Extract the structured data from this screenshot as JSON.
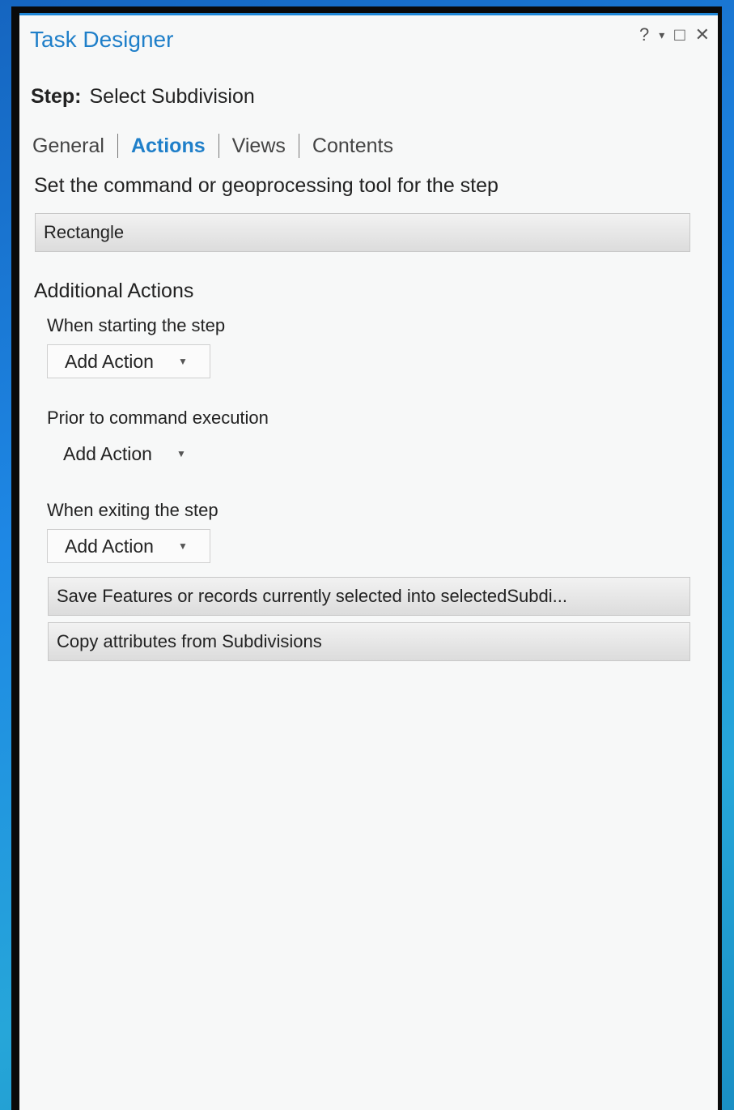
{
  "window": {
    "title": "Task Designer",
    "help": "?",
    "pin": "▾",
    "maximize": "□",
    "close": "✕"
  },
  "step": {
    "label": "Step:",
    "value": "Select Subdivision"
  },
  "tabs": [
    {
      "label": "General",
      "active": false
    },
    {
      "label": "Actions",
      "active": true
    },
    {
      "label": "Views",
      "active": false
    },
    {
      "label": "Contents",
      "active": false
    }
  ],
  "command": {
    "heading": "Set the command or geoprocessing tool for the step",
    "value": "Rectangle"
  },
  "additional": {
    "title": "Additional Actions",
    "starting_label": "When starting the step",
    "prior_label": "Prior to command execution",
    "exiting_label": "When exiting the step",
    "add_action_label": "Add Action",
    "exit_actions": [
      "Save Features or records currently selected into selectedSubdi...",
      "Copy attributes from Subdivisions"
    ]
  },
  "colors": {
    "accent": "#1f7fc9",
    "panel_bg": "#f7f8f8"
  }
}
